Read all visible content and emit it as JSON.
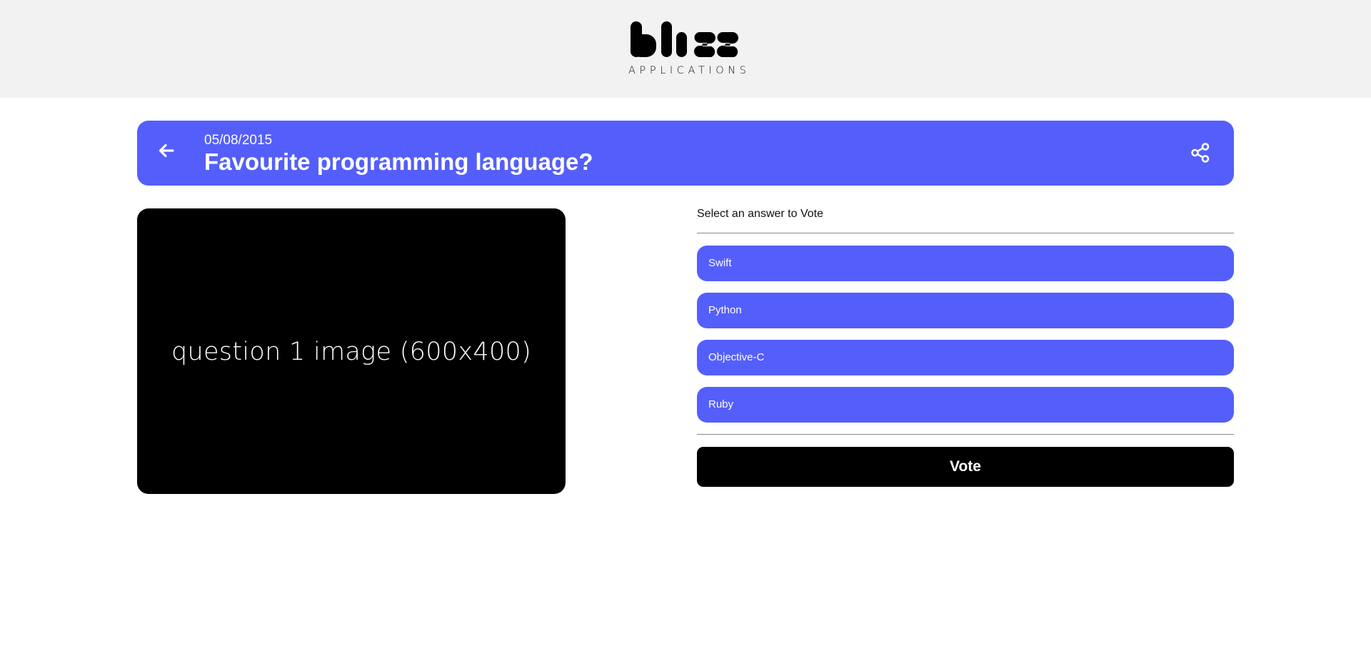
{
  "brand": {
    "name": "bliss",
    "subtitle": "APPLICATIONS"
  },
  "colors": {
    "accent": "#545ffb",
    "topbar": "#f2f2f2",
    "vote_button": "#000000"
  },
  "question": {
    "date": "05/08/2015",
    "title": "Favourite programming language?",
    "image_placeholder": "question 1 image (600x400)",
    "back_icon": "arrow-left-icon",
    "share_icon": "share-icon"
  },
  "vote": {
    "prompt": "Select an answer to Vote",
    "answers": [
      "Swift",
      "Python",
      "Objective-C",
      "Ruby"
    ],
    "button_label": "Vote"
  }
}
